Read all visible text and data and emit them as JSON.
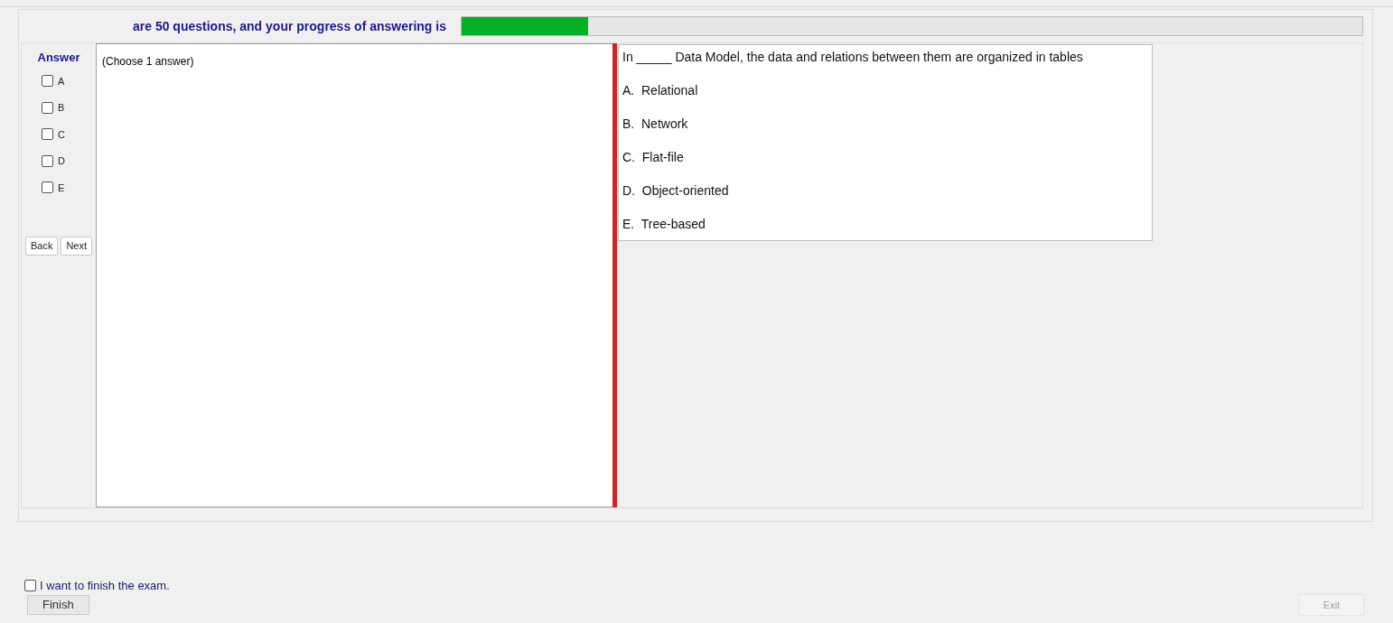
{
  "header": {
    "text": "are 50 questions, and your progress of answering is",
    "level": 0.14
  },
  "answer_panel": {
    "title": "Answer",
    "options": [
      {
        "label": "A",
        "checked": false
      },
      {
        "label": "B",
        "checked": false
      },
      {
        "label": "C",
        "checked": false
      },
      {
        "label": "D",
        "checked": false
      },
      {
        "label": "E",
        "checked": false
      }
    ],
    "buttons": [
      "Back",
      "Next"
    ]
  },
  "instruction": "(Choose 1 answer)",
  "question": {
    "text": "In _____ Data Model, the data and relations between them are organized in tables",
    "choices": [
      "A.  Relational",
      "B.  Network",
      "C.  Flat-file",
      "D.  Object-oriented",
      "E.  Tree-based"
    ]
  },
  "finish": {
    "label": "I want to finish the exam.",
    "checked": false,
    "button": "Finish"
  },
  "exit": {
    "label": "Exit",
    "disabled": true
  }
}
